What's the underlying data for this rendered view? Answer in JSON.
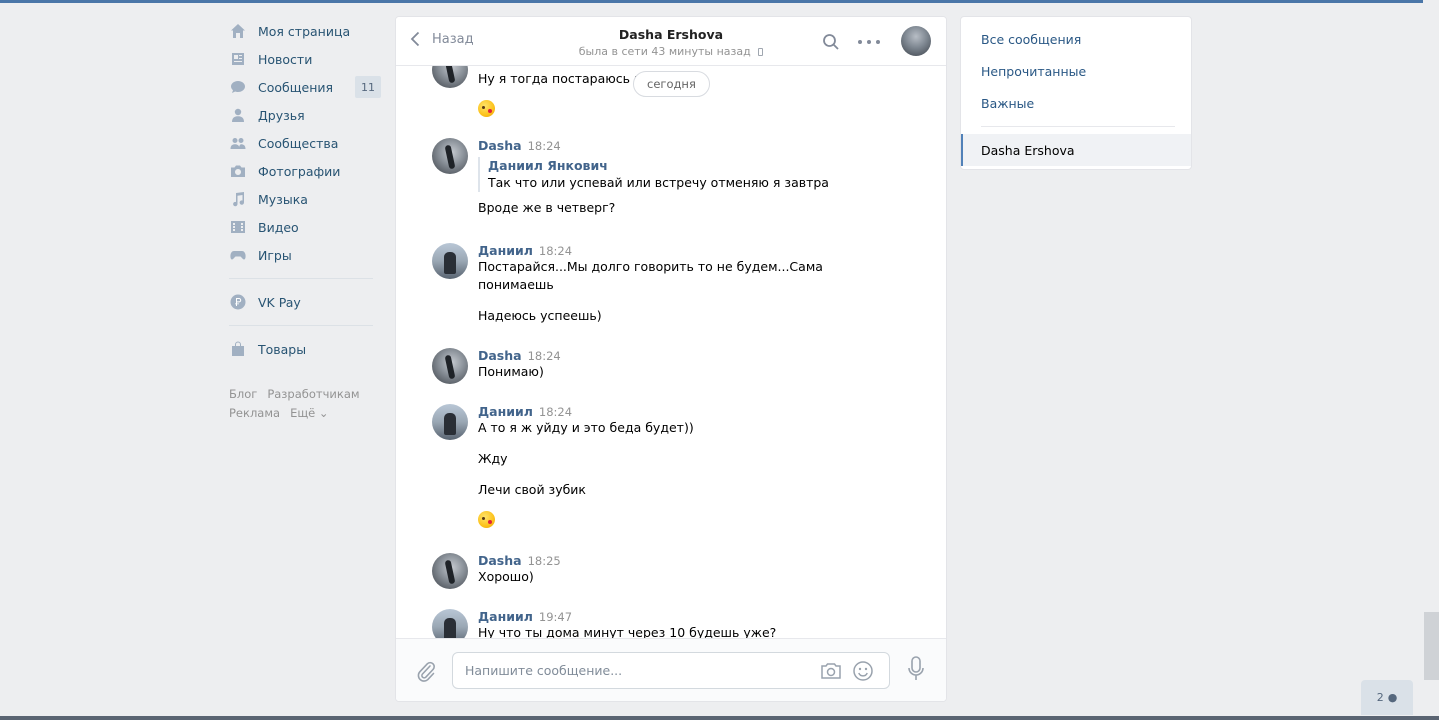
{
  "nav": {
    "items": [
      {
        "label": "Моя страница",
        "icon": "home-icon"
      },
      {
        "label": "Новости",
        "icon": "news-icon"
      },
      {
        "label": "Сообщения",
        "icon": "messages-icon",
        "badge": "11"
      },
      {
        "label": "Друзья",
        "icon": "friends-icon"
      },
      {
        "label": "Сообщества",
        "icon": "groups-icon"
      },
      {
        "label": "Фотографии",
        "icon": "camera-icon"
      },
      {
        "label": "Музыка",
        "icon": "music-icon"
      },
      {
        "label": "Видео",
        "icon": "video-icon"
      },
      {
        "label": "Игры",
        "icon": "games-icon"
      }
    ],
    "vkpay": "VK Pay",
    "goods": "Товары",
    "footer": {
      "blog": "Блог",
      "dev": "Разработчикам",
      "ads": "Реклама",
      "more": "Ещё ⌄"
    }
  },
  "chat": {
    "back_label": "Назад",
    "peer_name": "Dasha Ershova",
    "peer_status": "была в сети 43 минуты назад",
    "today_label": "сегодня",
    "messages": [
      {
        "author": "",
        "time": "",
        "lines": [
          "Ну я тогда постараюсь к 8"
        ],
        "emoji": true
      },
      {
        "author": "Dasha",
        "time": "18:24",
        "quote_author": "Даниил Янкович",
        "quote_text": "Так что или успевай или встречу отменяю я завтра",
        "lines": [
          "Вроде же в четверг?"
        ]
      },
      {
        "author": "Даниил",
        "time": "18:24",
        "lines": [
          "Постарайся...Мы долго говорить то не будем...Сама",
          "понимаешь",
          "Надеюсь успеешь)"
        ]
      },
      {
        "author": "Dasha",
        "time": "18:24",
        "lines": [
          "Понимаю)"
        ]
      },
      {
        "author": "Даниил",
        "time": "18:24",
        "lines": [
          "А то я ж уйду и это беда будет))",
          "Жду",
          "Лечи свой зубик"
        ],
        "emoji": true
      },
      {
        "author": "Dasha",
        "time": "18:25",
        "lines": [
          "Хорошо)"
        ]
      },
      {
        "author": "Даниил",
        "time": "19:47",
        "lines": [
          "Ну что ты дома минут через 10 будешь уже?"
        ]
      }
    ],
    "composer_placeholder": "Напишите сообщение..."
  },
  "right_menu": {
    "all": "Все сообщения",
    "unread": "Непрочитанные",
    "important": "Важные",
    "active_chat": "Dasha Ershova"
  },
  "friends_online": "2"
}
